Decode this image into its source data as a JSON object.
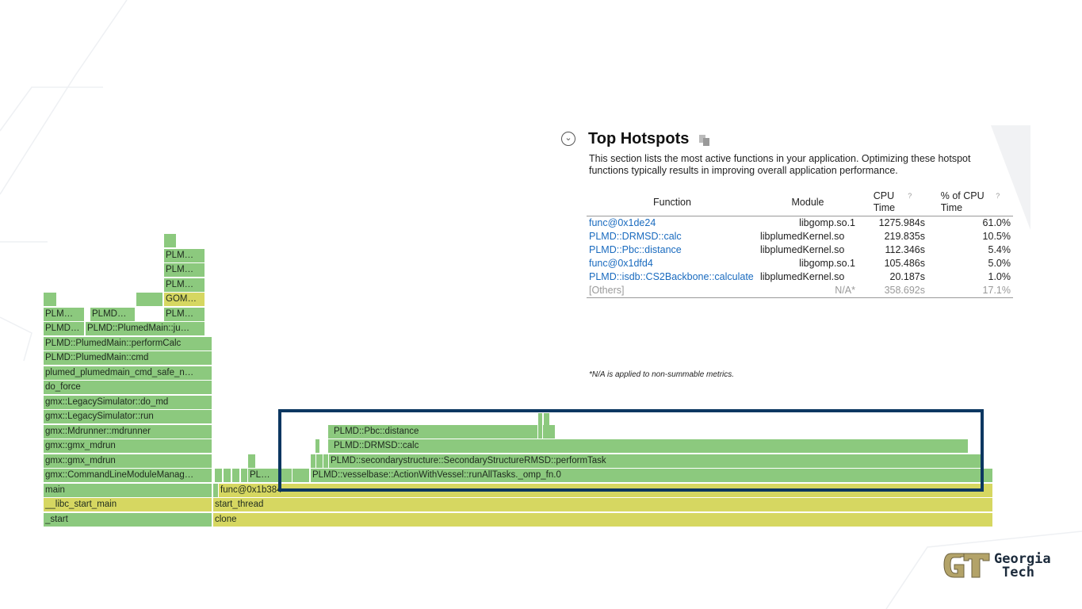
{
  "flame": {
    "left": [
      {
        "label": "PLM…"
      },
      {
        "label": "PLM…"
      },
      {
        "label": "PLM…"
      },
      {
        "label": "GOM…"
      },
      {
        "label": "PLM…"
      },
      {
        "label": "PLMD…"
      },
      {
        "label": "PLM…"
      },
      {
        "label": "PLMD…"
      },
      {
        "label": "PLMD::PlumedMain::ju…"
      },
      {
        "label": "PLMD::PlumedMain::performCalc"
      },
      {
        "label": "PLMD::PlumedMain::cmd"
      },
      {
        "label": "plumed_plumedmain_cmd_safe_n…"
      },
      {
        "label": "do_force"
      },
      {
        "label": "gmx::LegacySimulator::do_md"
      },
      {
        "label": "gmx::LegacySimulator::run"
      },
      {
        "label": "gmx::Mdrunner::mdrunner"
      },
      {
        "label": "gmx::gmx_mdrun"
      },
      {
        "label": "gmx::gmx_mdrun"
      },
      {
        "label": "gmx::CommandLineModuleManag…"
      },
      {
        "label": "main"
      },
      {
        "label": "__libc_start_main"
      },
      {
        "label": "_start"
      }
    ],
    "right": {
      "pbc_distance": "PLMD::Pbc::distance",
      "drmsd_calc": "PLMD::DRMSD::calc",
      "perform_task": "PLMD::secondarystructure::SecondaryStructureRMSD::performTask",
      "run_all_tasks": "PLMD::vesselbase::ActionWithVessel::runAllTasks._omp_fn.0",
      "pl_small": "PL…",
      "func": "func@0x1b384",
      "start_thread": "start_thread",
      "clone": "clone"
    }
  },
  "hotspots": {
    "title": "Top Hotspots",
    "description": "This section lists the most active functions in your application. Optimizing these hotspot functions typically results in improving overall application performance.",
    "columns": [
      "Function",
      "Module",
      "CPU Time",
      "% of CPU Time"
    ],
    "help_glyph": "?",
    "rows": [
      {
        "function": "func@0x1de24",
        "module": "libgomp.so.1",
        "cpu_time": "1275.984s",
        "pct": "61.0%"
      },
      {
        "function": "PLMD::DRMSD::calc",
        "module": "libplumedKernel.so",
        "cpu_time": "219.835s",
        "pct": "10.5%"
      },
      {
        "function": "PLMD::Pbc::distance",
        "module": "libplumedKernel.so",
        "cpu_time": "112.346s",
        "pct": "5.4%"
      },
      {
        "function": "func@0x1dfd4",
        "module": "libgomp.so.1",
        "cpu_time": "105.486s",
        "pct": "5.0%"
      },
      {
        "function": "PLMD::isdb::CS2Backbone::calculate",
        "module": "libplumedKernel.so",
        "cpu_time": "20.187s",
        "pct": "1.0%"
      }
    ],
    "others": {
      "function": "[Others]",
      "module": "N/A*",
      "cpu_time": "358.692s",
      "pct": "17.1%"
    },
    "note": "*N/A is applied to non-summable metrics."
  },
  "logo": {
    "line1": "Georgia",
    "line2": "Tech"
  },
  "colors": {
    "frame_green": "#8cc97e",
    "frame_yellow": "#d6d761",
    "box_navy": "#0c3761",
    "link_blue": "#1a6bbf"
  }
}
